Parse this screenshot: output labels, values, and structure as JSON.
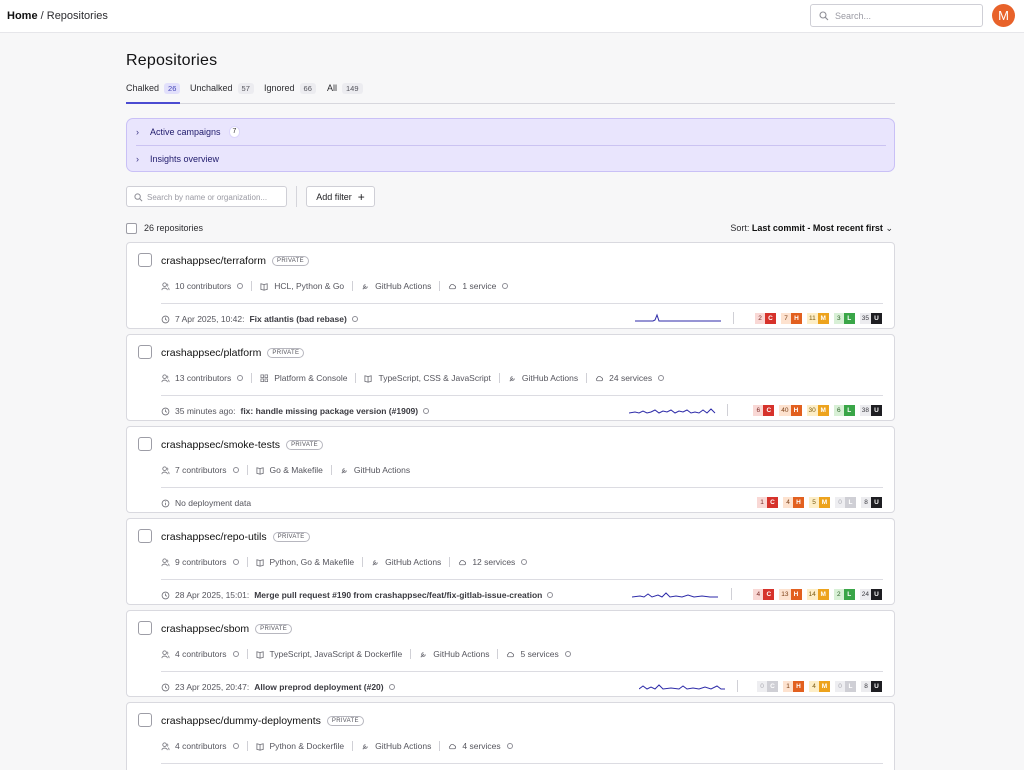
{
  "header": {
    "home": "Home",
    "sep": "/",
    "current": "Repositories",
    "search_placeholder": "Search...",
    "avatar": "M"
  },
  "page_title": "Repositories",
  "tabs": [
    {
      "label": "Chalked",
      "count": "26"
    },
    {
      "label": "Unchalked",
      "count": "57"
    },
    {
      "label": "Ignored",
      "count": "66"
    },
    {
      "label": "All",
      "count": "149"
    }
  ],
  "campaigns": {
    "active_label": "Active campaigns",
    "active_count": "7",
    "insights_label": "Insights overview"
  },
  "filters": {
    "search_placeholder": "Search by name or organization...",
    "add_filter": "Add filter"
  },
  "list": {
    "count_text": "26 repositories",
    "sort_prefix": "Sort:",
    "sort_value": "Last commit - Most recent first"
  },
  "severity_letters": {
    "c": "C",
    "h": "H",
    "m": "M",
    "l": "L",
    "u": "U"
  },
  "repos": [
    {
      "name": "crashappsec/terraform",
      "badge": "PRIVATE",
      "contributors": "10 contributors",
      "languages": "HCL, Python & Go",
      "ci": "GitHub Actions",
      "services": "1 service",
      "commit_prefix": "7 Apr 2025, 10:42:",
      "commit_msg": "Fix atlantis (bad rebase)",
      "sev": {
        "c": "2",
        "h": "7",
        "m": "11",
        "l": "3",
        "u": "35"
      }
    },
    {
      "name": "crashappsec/platform",
      "badge": "PRIVATE",
      "contributors": "13 contributors",
      "platform": "Platform & Console",
      "languages": "TypeScript, CSS & JavaScript",
      "ci": "GitHub Actions",
      "services": "24 services",
      "commit_prefix": "35 minutes ago:",
      "commit_msg": "fix: handle missing package version (#1909)",
      "sev": {
        "c": "6",
        "h": "40",
        "m": "30",
        "l": "6",
        "u": "38"
      }
    },
    {
      "name": "crashappsec/smoke-tests",
      "badge": "PRIVATE",
      "contributors": "7 contributors",
      "languages": "Go & Makefile",
      "ci": "GitHub Actions",
      "no_deploy": "No deployment data",
      "sev": {
        "c": "1",
        "h": "4",
        "m": "5",
        "l": "0",
        "u": "8"
      }
    },
    {
      "name": "crashappsec/repo-utils",
      "badge": "PRIVATE",
      "contributors": "9 contributors",
      "languages": "Python, Go & Makefile",
      "ci": "GitHub Actions",
      "services": "12 services",
      "commit_prefix": "28 Apr 2025, 15:01:",
      "commit_msg": "Merge pull request #190 from crashappsec/feat/fix-gitlab-issue-creation",
      "sev": {
        "c": "4",
        "h": "13",
        "m": "14",
        "l": "2",
        "u": "24"
      }
    },
    {
      "name": "crashappsec/sbom",
      "badge": "PRIVATE",
      "contributors": "4 contributors",
      "languages": "TypeScript, JavaScript & Dockerfile",
      "ci": "GitHub Actions",
      "services": "5 services",
      "commit_prefix": "23 Apr 2025, 20:47:",
      "commit_msg": "Allow preprod deployment (#20)",
      "sev": {
        "c": "0",
        "h": "1",
        "m": "4",
        "l": "0",
        "u": "8"
      }
    },
    {
      "name": "crashappsec/dummy-deployments",
      "badge": "PRIVATE",
      "contributors": "4 contributors",
      "languages": "Python & Dockerfile",
      "ci": "GitHub Actions",
      "services": "4 services"
    }
  ]
}
